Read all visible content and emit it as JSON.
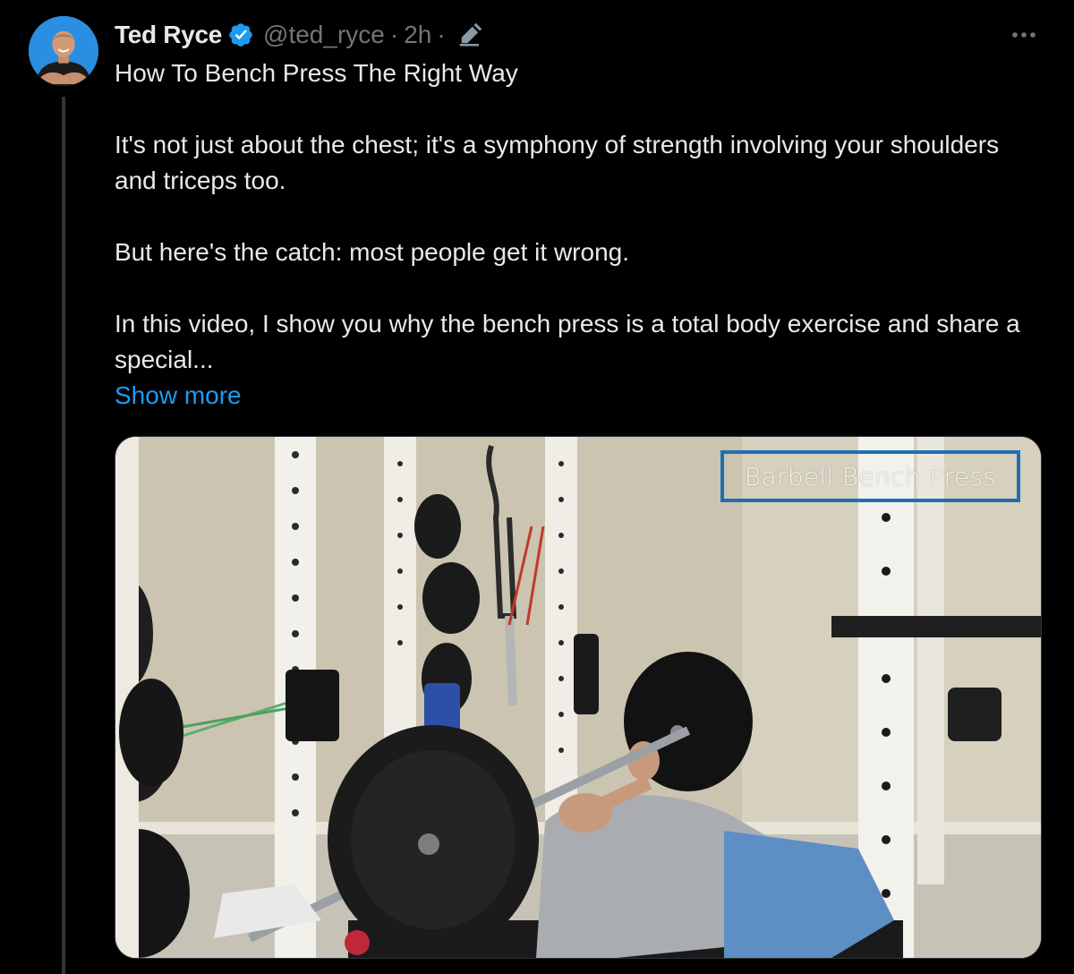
{
  "author": {
    "display_name": "Ted Ryce",
    "handle": "@ted_ryce",
    "separator": "·",
    "time": "2h",
    "verified": true,
    "verified_icon": "verified-badge-icon",
    "edited_icon": "edit-pencil-icon"
  },
  "tweet": {
    "paragraphs": [
      "How To Bench Press The Right Way",
      "It's not just about the chest; it's a symphony of strength involving your shoulders and triceps too.",
      "But here's the catch: most people get it wrong.",
      "In this video, I show you why the bench press is a total body exercise and share a special..."
    ],
    "show_more": "Show more"
  },
  "media": {
    "type": "video-thumbnail",
    "overlay_text": "Barbell Bench Press"
  },
  "menu_icon": "more-options-icon",
  "colors": {
    "background": "#000000",
    "text": "#e7e9ea",
    "muted": "#71767b",
    "accent": "#1d9bf0",
    "overlay_border": "#1f6fb4"
  }
}
